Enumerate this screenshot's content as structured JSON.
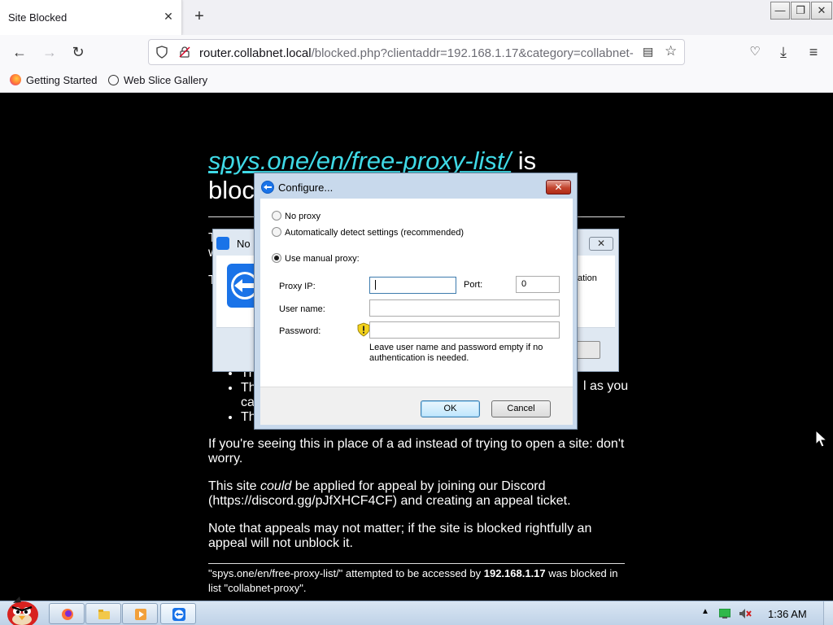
{
  "browser": {
    "tab_title": "Site Blocked",
    "url_host": "router.collabnet.local",
    "url_rest": "/blocked.php?clientaddr=192.168.1.17&category=collabnet-",
    "bookmarks": [
      "Getting Started",
      "Web Slice Gallery"
    ]
  },
  "page": {
    "headline_link": "spys.one/en/free-proxy-list/",
    "headline_rest": " is",
    "headline_line2": "bloc",
    "bullet_fragments": [
      "Th",
      "Th",
      "Th"
    ],
    "bullet_tail": "l as you",
    "bullet_tail2": "ca",
    "para_ad": "If you're seeing this in place of a ad instead of trying to open a site: don't worry.",
    "para_appeal_1": "This site ",
    "para_appeal_em": "could",
    "para_appeal_2": " be applied for appeal by joining our Discord (https://discord.gg/pJfXHCF4CF) and creating an appeal ticket.",
    "para_note": "Note that appeals may not matter; if the site is blocked rightfully an appeal will not unblock it.",
    "footer_1": "\"spys.one/en/free-proxy-list/\" attempted to be accessed by ",
    "footer_ip": "192.168.1.17",
    "footer_2": " was blocked in list \"collabnet-proxy\"."
  },
  "bg_dialog": {
    "title_fragment": "No",
    "body_fragment": "ation",
    "left_fragments": [
      "T",
      "w",
      "T"
    ]
  },
  "dialog": {
    "title": "Configure...",
    "radio_no_proxy": "No proxy",
    "radio_auto": "Automatically detect settings (recommended)",
    "radio_manual": "Use manual proxy:",
    "selected": "manual",
    "proxy_ip_label": "Proxy IP:",
    "proxy_ip_value": "",
    "port_label": "Port:",
    "port_value": "0",
    "username_label": "User name:",
    "username_value": "",
    "password_label": "Password:",
    "password_value": "",
    "note": "Leave user name and password empty if no authentication is needed.",
    "ok_label": "OK",
    "cancel_label": "Cancel"
  },
  "taskbar": {
    "clock": "1:36 AM",
    "items": [
      "firefox-icon",
      "folder-icon",
      "media-player-icon",
      "teamviewer-icon"
    ]
  },
  "colors": {
    "link": "#3fd9e6",
    "page_bg": "#000000",
    "dialog_frame": "#c8d9ec",
    "close_red": "#c3442e"
  }
}
